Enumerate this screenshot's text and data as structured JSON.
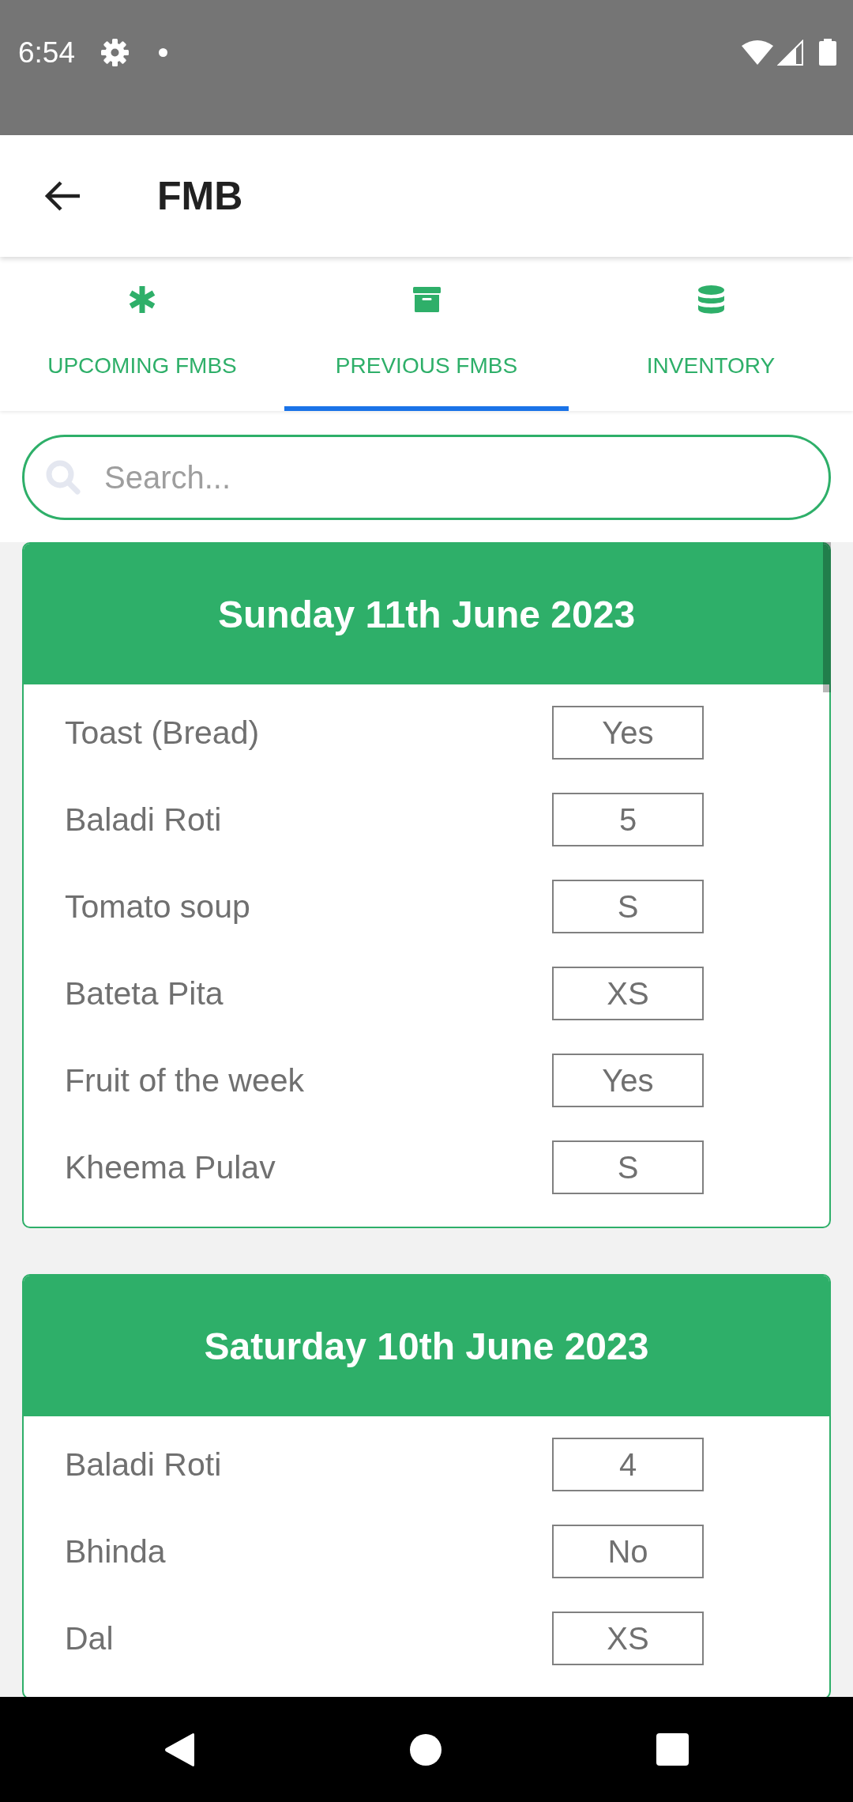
{
  "status_bar": {
    "time": "6:54"
  },
  "app_bar": {
    "title": "FMB"
  },
  "tabs": [
    {
      "label": "UPCOMING FMBS",
      "selected": false
    },
    {
      "label": "PREVIOUS FMBS",
      "selected": true
    },
    {
      "label": "INVENTORY",
      "selected": false
    }
  ],
  "search": {
    "placeholder": "Search..."
  },
  "days": [
    {
      "date": "Sunday 11th June 2023",
      "items": [
        {
          "name": "Toast (Bread)",
          "value": "Yes"
        },
        {
          "name": "Baladi Roti",
          "value": "5"
        },
        {
          "name": "Tomato soup",
          "value": "S"
        },
        {
          "name": "Bateta Pita",
          "value": "XS"
        },
        {
          "name": "Fruit of the week",
          "value": "Yes"
        },
        {
          "name": "Kheema Pulav",
          "value": "S"
        }
      ]
    },
    {
      "date": "Saturday 10th June 2023",
      "items": [
        {
          "name": "Baladi Roti",
          "value": "4"
        },
        {
          "name": "Bhinda",
          "value": "No"
        },
        {
          "name": "Dal",
          "value": "XS"
        }
      ]
    }
  ]
}
